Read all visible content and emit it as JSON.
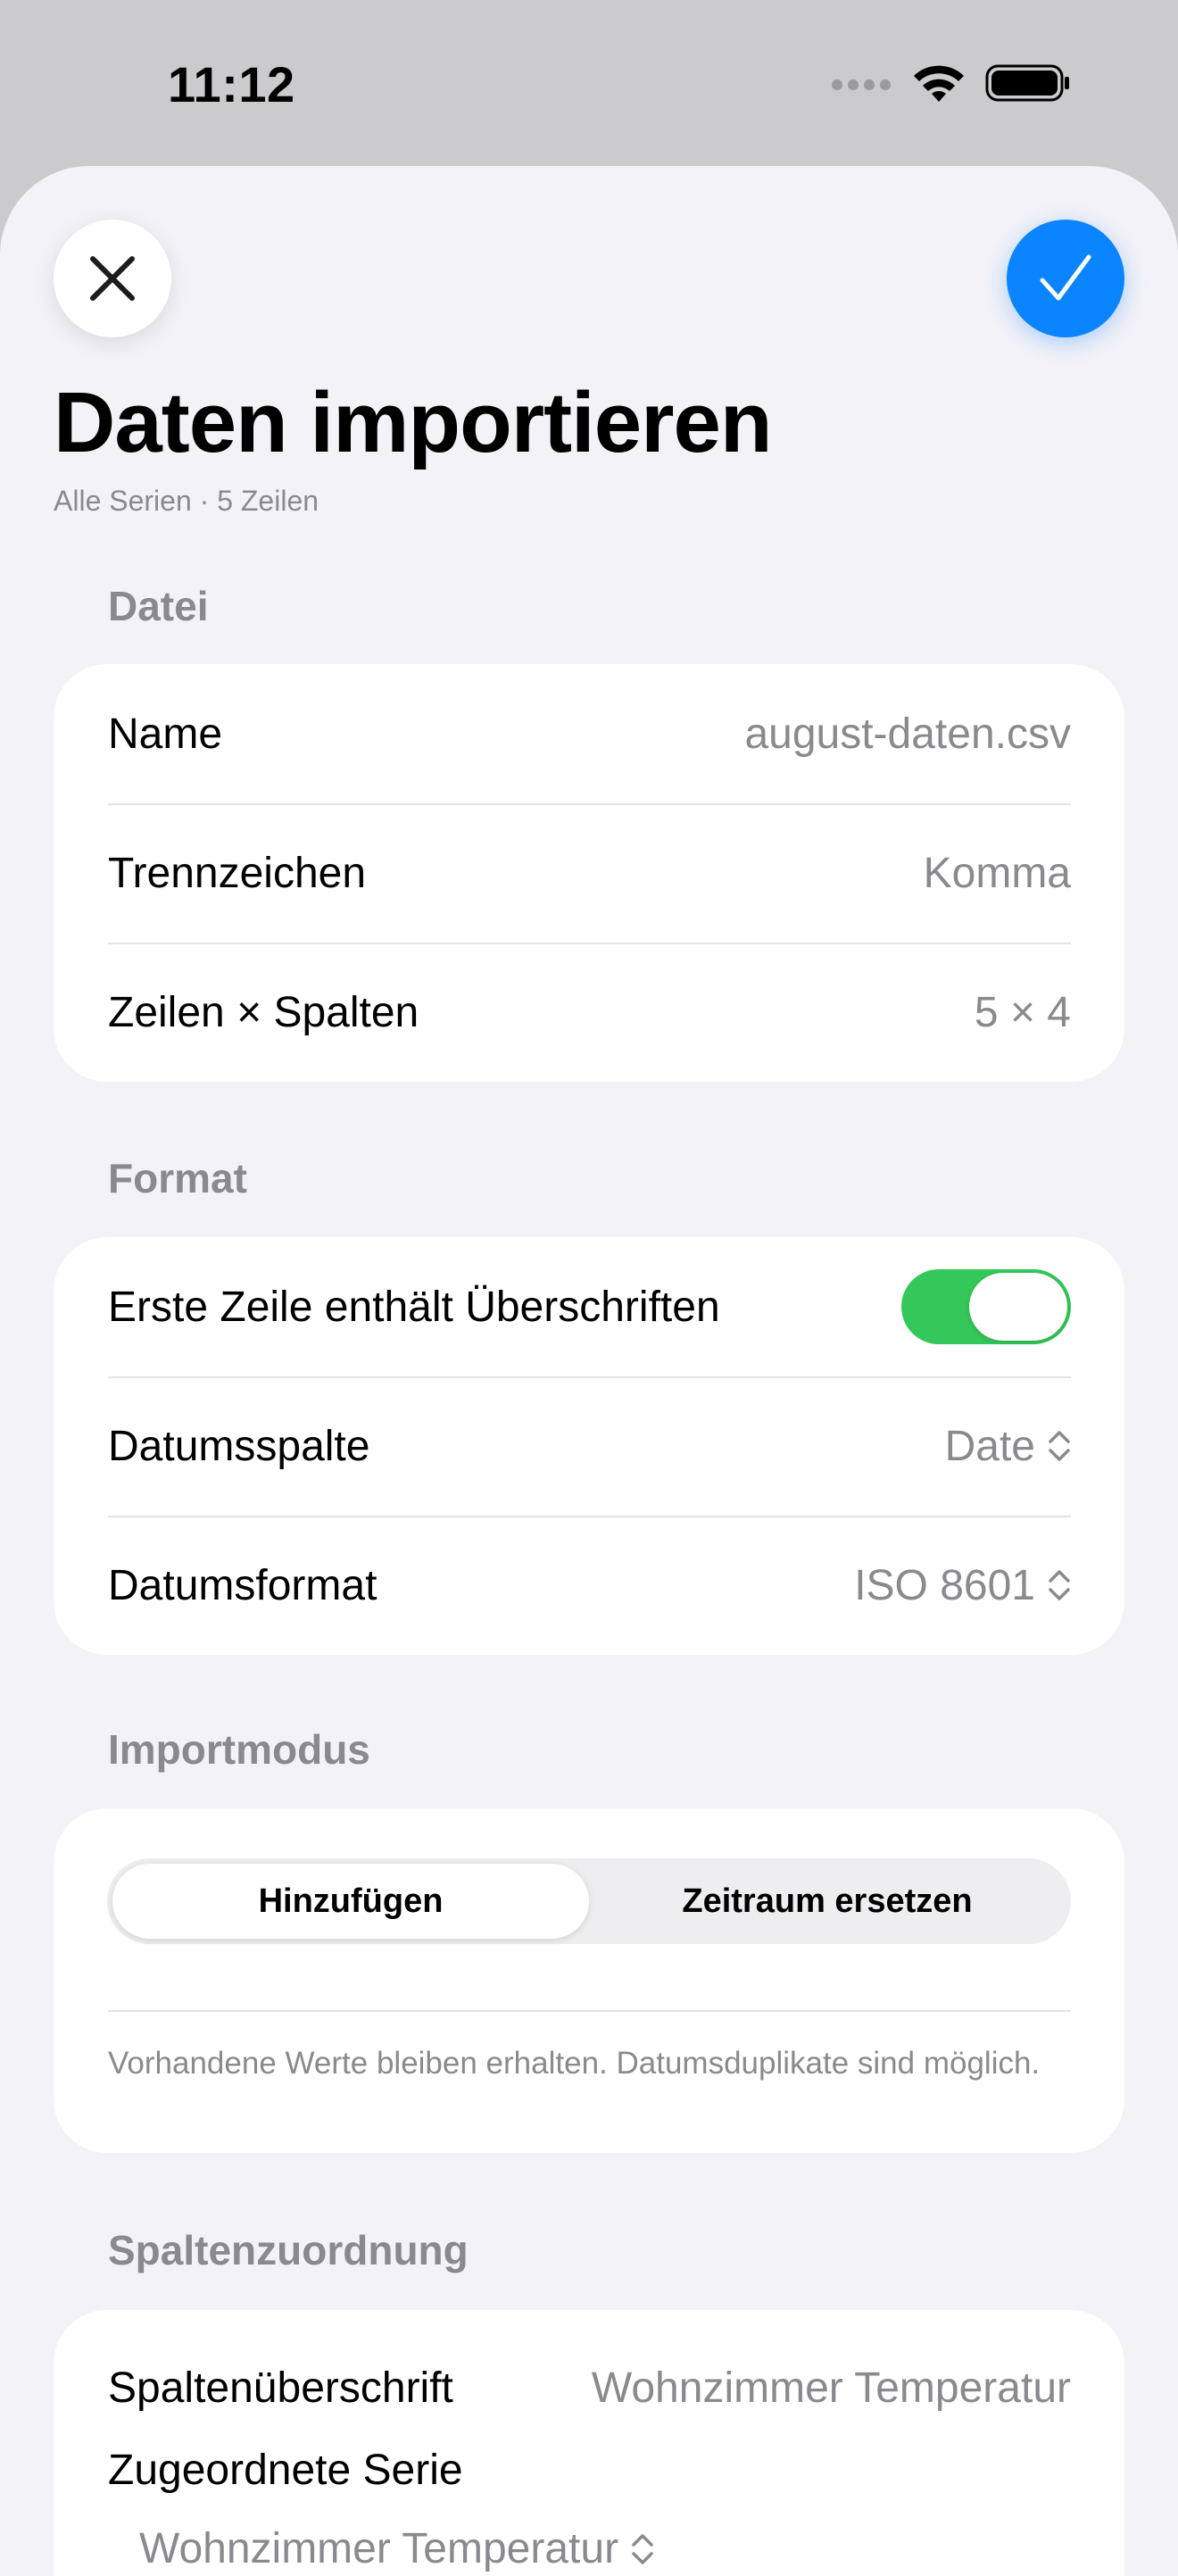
{
  "status": {
    "time": "11:12"
  },
  "sheet": {
    "title": "Daten importieren",
    "subtitle": "Alle Serien · 5 Zeilen"
  },
  "sections": {
    "file": {
      "label": "Datei",
      "rows": [
        {
          "label": "Name",
          "value": "august-daten.csv"
        },
        {
          "label": "Trennzeichen",
          "value": "Komma"
        },
        {
          "label": "Zeilen × Spalten",
          "value": "5 × 4"
        }
      ]
    },
    "format": {
      "label": "Format",
      "header_toggle": {
        "label": "Erste Zeile enthält Überschriften",
        "on": true
      },
      "date_column": {
        "label": "Datumsspalte",
        "value": "Date"
      },
      "date_format": {
        "label": "Datumsformat",
        "value": "ISO 8601"
      }
    },
    "import_mode": {
      "label": "Importmodus",
      "options": [
        "Hinzufügen",
        "Zeitraum ersetzen"
      ],
      "selected": "Hinzufügen",
      "note": "Vorhandene Werte bleiben erhalten. Datumsduplikate sind möglich."
    },
    "mapping": {
      "label": "Spaltenzuordnung",
      "column_header_label": "Spaltenüberschrift",
      "column_header_value": "Wohnzimmer Temperatur",
      "series_label": "Zugeordnete Serie",
      "series_value": "Wohnzimmer Temperatur"
    }
  },
  "colors": {
    "accent": "#0a84ff",
    "toggle_on": "#34c759",
    "background": "#f2f2f7"
  }
}
